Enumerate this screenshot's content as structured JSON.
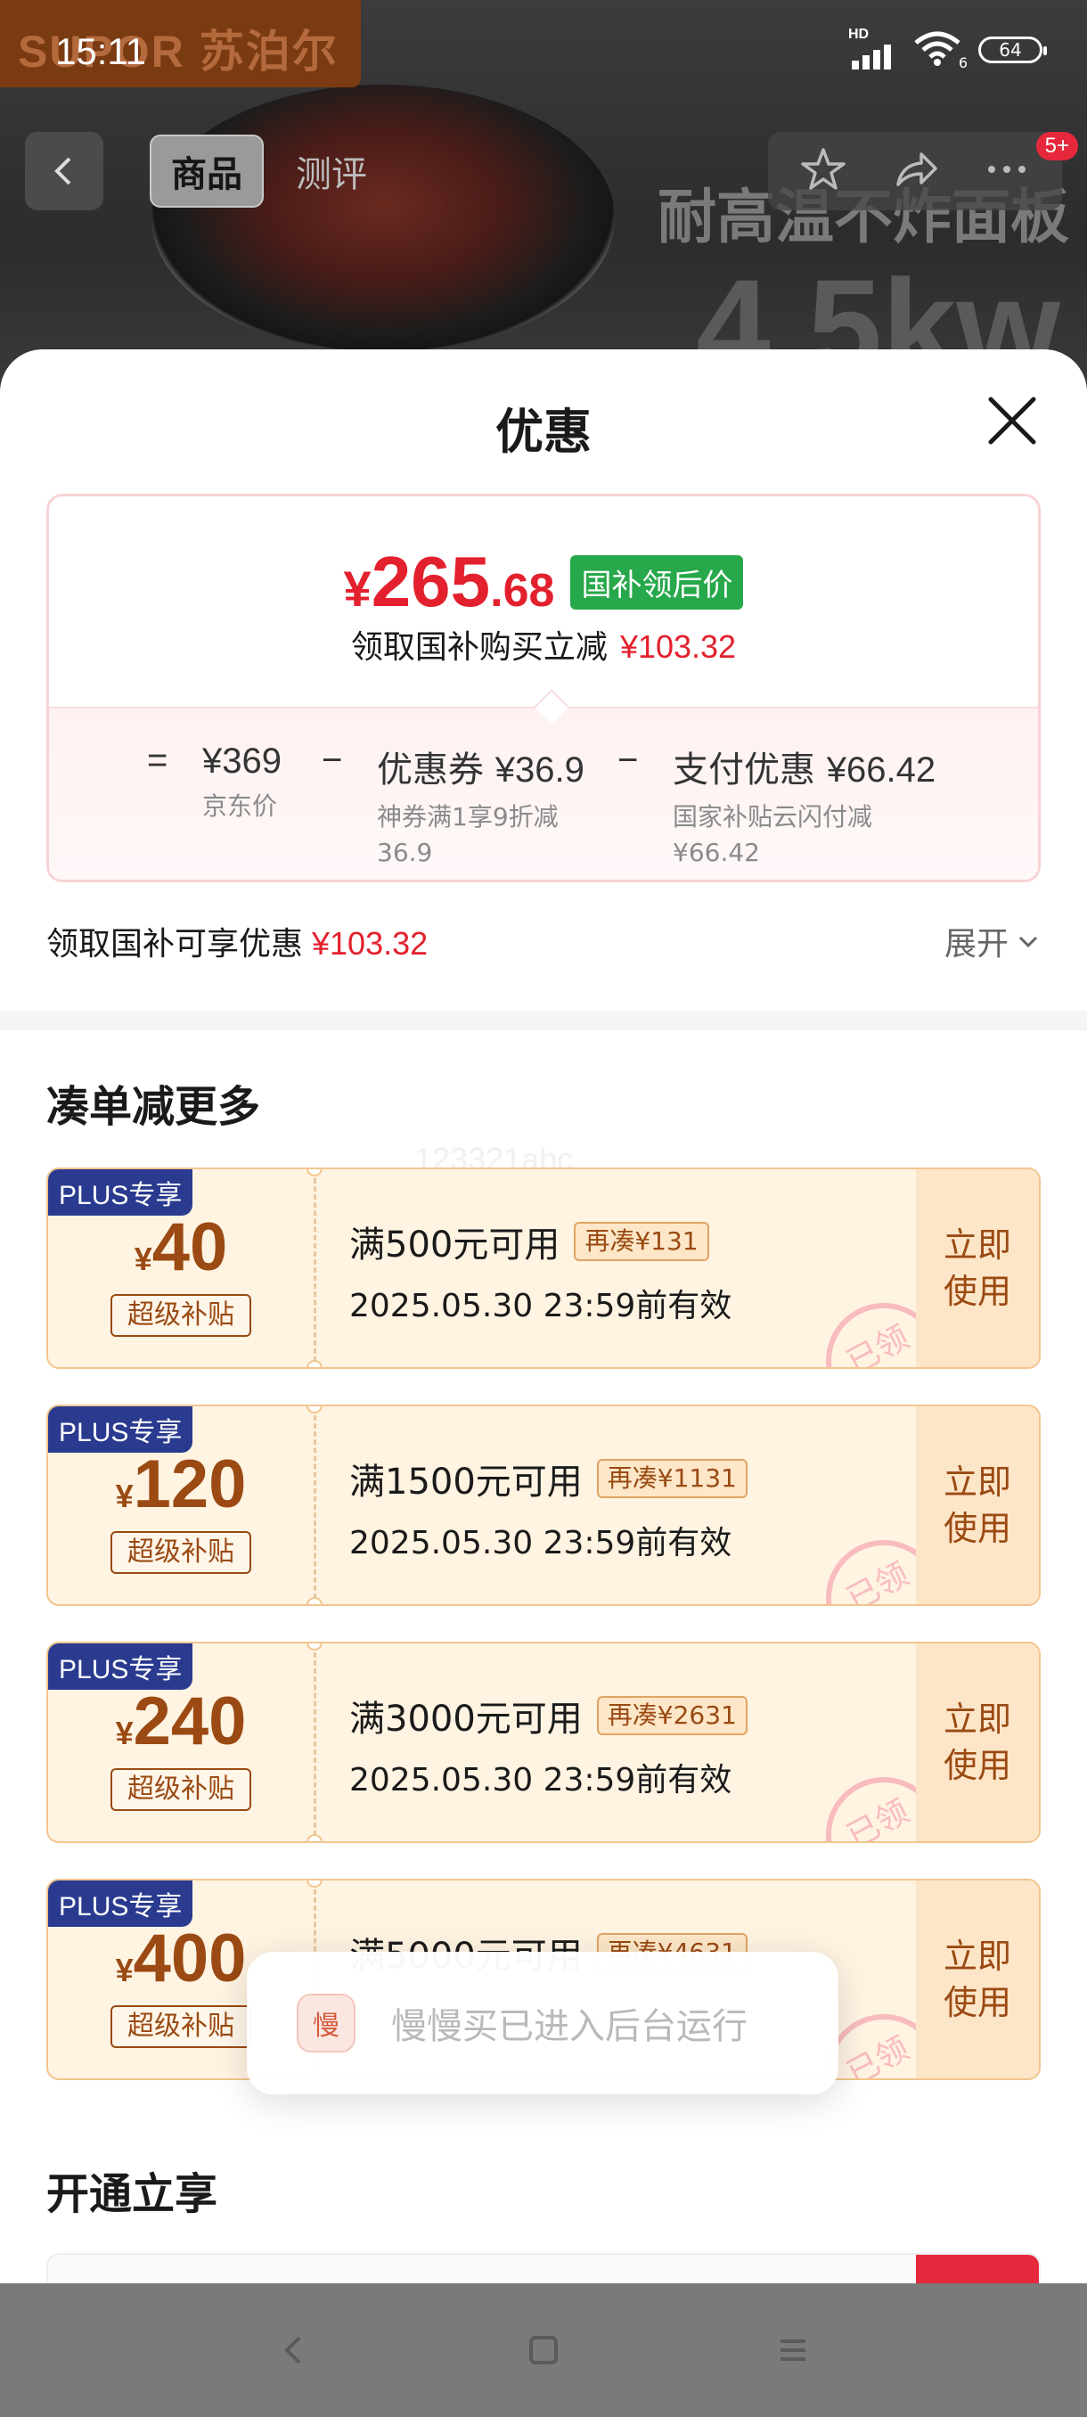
{
  "status": {
    "time": "15:11",
    "network": "HD",
    "wifi_label": "6",
    "battery": "64"
  },
  "background": {
    "brand": "SUPOR 苏泊尔",
    "slogan": "耐高温不炸面板",
    "power": "4.5kw",
    "tabs": [
      "商品",
      "测评"
    ],
    "badge": "5+"
  },
  "sheet": {
    "title": "优惠",
    "price": {
      "yen": "¥",
      "int": "265",
      "dec": ".68",
      "tag": "国补领后价",
      "subtitle": "领取国补购买立减",
      "subtitle_amount": "¥103.32"
    },
    "breakdown": {
      "eq": "=",
      "op1": "−",
      "op2": "−",
      "items": [
        {
          "main_label": "",
          "main_value": "¥369",
          "sub": "京东价"
        },
        {
          "main_label": "优惠券",
          "main_value": "¥36.9",
          "sub": "神券满1享9折减36.9"
        },
        {
          "main_label": "支付优惠",
          "main_value": "¥66.42",
          "sub": "国家补贴云闪付减¥66.42"
        }
      ]
    },
    "claim": {
      "label": "领取国补可享优惠",
      "amount": "¥103.32",
      "expand": "展开"
    },
    "section_more": "凑单减更多",
    "watermark": "123321abc",
    "coupons": [
      {
        "plus": "PLUS专享",
        "yen": "¥",
        "value": "40",
        "badge": "超级补贴",
        "condition": "满500元可用",
        "extra": "再凑¥131",
        "date": "2025.05.30 23:59前有效",
        "use": "立即使用",
        "stamp": "已领"
      },
      {
        "plus": "PLUS专享",
        "yen": "¥",
        "value": "120",
        "badge": "超级补贴",
        "condition": "满1500元可用",
        "extra": "再凑¥1131",
        "date": "2025.05.30 23:59前有效",
        "use": "立即使用",
        "stamp": "已领"
      },
      {
        "plus": "PLUS专享",
        "yen": "¥",
        "value": "240",
        "badge": "超级补贴",
        "condition": "满3000元可用",
        "extra": "再凑¥2631",
        "date": "2025.05.30 23:59前有效",
        "use": "立即使用",
        "stamp": "已领"
      },
      {
        "plus": "PLUS专享",
        "yen": "¥",
        "value": "400",
        "badge": "超级补贴",
        "condition": "满5000元可用",
        "extra": "再凑¥4631",
        "date": "",
        "use": "立即使用",
        "stamp": "已领"
      }
    ],
    "section_open": "开通立享"
  },
  "toast": {
    "text": "慢慢买已进入后台运行",
    "icon_glyph": "慢"
  },
  "colors": {
    "price_red": "#e3202d",
    "subsidy_green": "#27a84a",
    "coupon_brown": "#9a4a12",
    "plus_blue": "#2a3b8f",
    "stamp_pink": "#f8bcbc"
  }
}
